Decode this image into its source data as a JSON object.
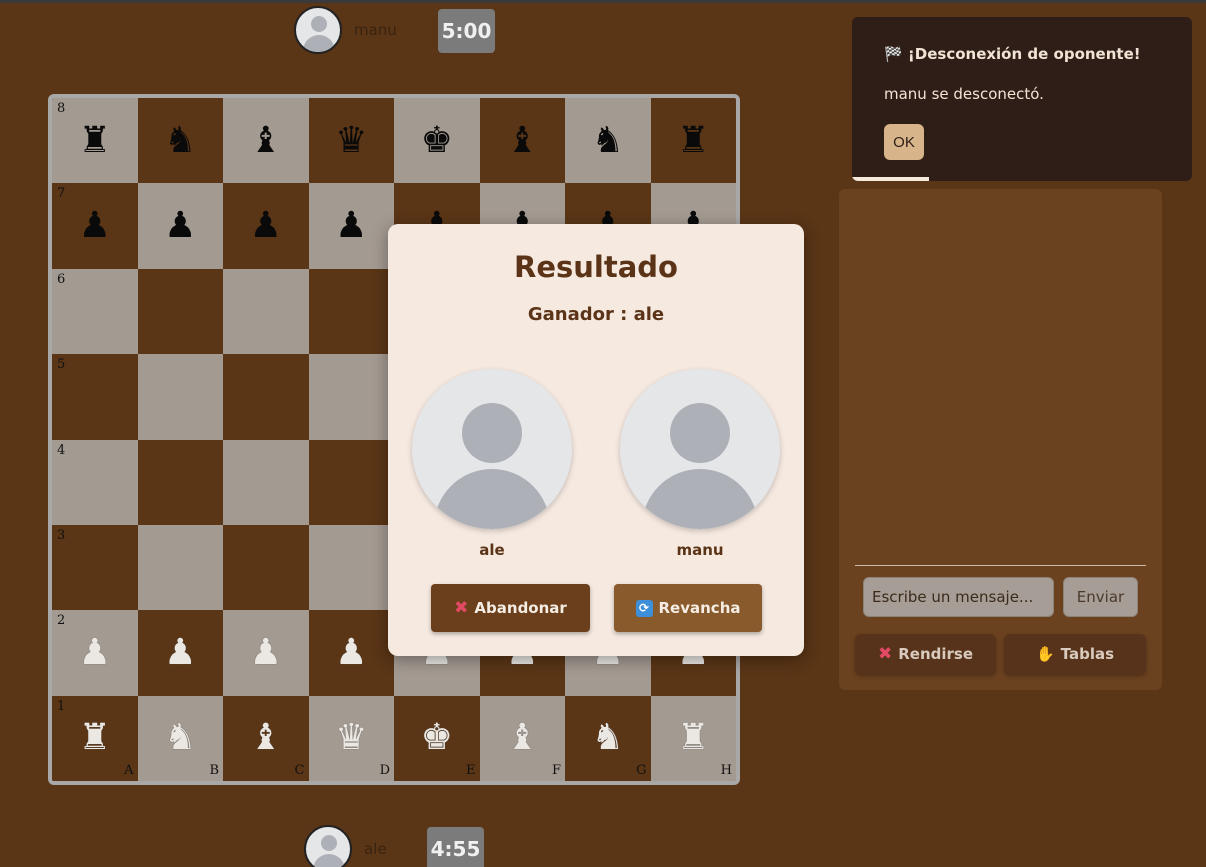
{
  "top_player": {
    "name": "manu",
    "clock": "5:00"
  },
  "bottom_player": {
    "name": "ale",
    "clock": "4:55"
  },
  "board": {
    "ranks": [
      "8",
      "7",
      "6",
      "5",
      "4",
      "3",
      "2",
      "1"
    ],
    "files": [
      "A",
      "B",
      "C",
      "D",
      "E",
      "F",
      "G",
      "H"
    ],
    "position": [
      [
        "br",
        "bn",
        "bb",
        "bq",
        "bk",
        "bb",
        "bn",
        "br"
      ],
      [
        "bp",
        "bp",
        "bp",
        "bp",
        "bp",
        "bp",
        "bp",
        "bp"
      ],
      [
        "",
        "",
        "",
        "",
        "",
        "",
        "",
        ""
      ],
      [
        "",
        "",
        "",
        "",
        "",
        "",
        "",
        ""
      ],
      [
        "",
        "",
        "",
        "",
        "",
        "",
        "",
        ""
      ],
      [
        "",
        "",
        "",
        "",
        "",
        "",
        "",
        ""
      ],
      [
        "wp",
        "wp",
        "wp",
        "wp",
        "wp",
        "wp",
        "wp",
        "wp"
      ],
      [
        "wr",
        "wn",
        "wb",
        "wq",
        "wk",
        "wb",
        "wn",
        "wr"
      ]
    ]
  },
  "notification": {
    "icon": "🏁",
    "title": "¡Desconexión de oponente!",
    "message": "manu se desconectó.",
    "ok_label": "OK"
  },
  "chat": {
    "placeholder": "Escribe un mensaje...",
    "send_label": "Enviar",
    "resign_label": "Rendirse",
    "draw_label": "Tablas"
  },
  "result_modal": {
    "title": "Resultado",
    "winner_text": "Ganador : ale",
    "player_left": "ale",
    "player_right": "manu",
    "abandon_label": "Abandonar",
    "rematch_label": "Revancha"
  },
  "colors": {
    "background": "#5a3516",
    "light_square": "#a39a91",
    "dark_square": "#5a3516",
    "modal_bg": "#f5e9e0",
    "notification_bg": "#2e1e17"
  }
}
